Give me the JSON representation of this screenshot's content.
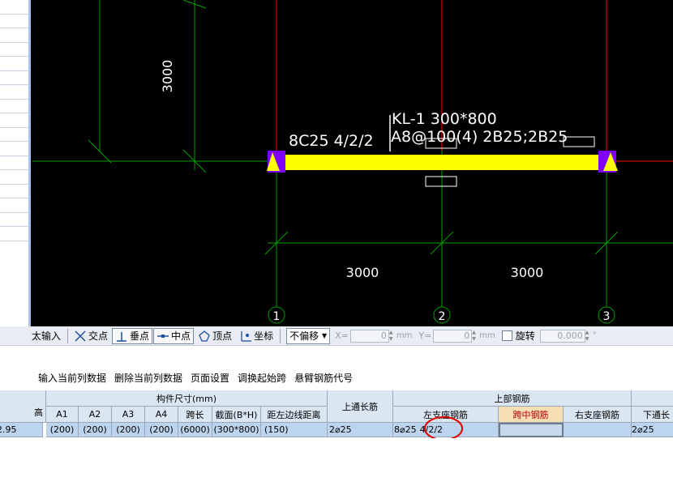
{
  "left_panel": {
    "row_count": 17
  },
  "drawing": {
    "grid_axes": [
      "1",
      "2",
      "3"
    ],
    "vertical_dimension": "3000",
    "span_dimensions": [
      "3000",
      "3000"
    ],
    "beam_name": "KL-1 300*800",
    "beam_stirrup_and_bars": "A8@100(4) 2B25;2B25",
    "left_support_label": "8C25 4/2/2",
    "colors": {
      "background": "#000000",
      "grid": "#00a000",
      "axis_red": "#ff0000",
      "beam": "#ffff00",
      "support": "#8000ff"
    }
  },
  "snap_toolbar": {
    "input_label": "太输入",
    "buttons": [
      {
        "label": "交点",
        "icon": "intersection-icon"
      },
      {
        "label": "垂点",
        "icon": "perpendicular-icon"
      },
      {
        "label": "中点",
        "icon": "midpoint-icon"
      },
      {
        "label": "顶点",
        "icon": "vertex-icon"
      },
      {
        "label": "坐标",
        "icon": "coordinate-icon"
      }
    ],
    "offset_select": "不偏移",
    "x_label": "X=",
    "x_value": "0",
    "x_unit": "mm",
    "y_label": "Y=",
    "y_value": "0",
    "y_unit": "mm",
    "rotate_label": "旋转",
    "rotate_value": "0.000",
    "degree_symbol": "°"
  },
  "menu": [
    "输入当前列数据",
    "删除当前列数据",
    "页面设置",
    "调换起始跨",
    "悬臂钢筋代号"
  ],
  "table": {
    "group_headers": {
      "component_size": "构件尺寸(mm)",
      "top_bars": "上部钢筋"
    },
    "col_headers": {
      "elevation_partial": "高",
      "a1": "A1",
      "a2": "A2",
      "a3": "A3",
      "a4": "A4",
      "span_length": "跨长",
      "section": "截面(B*H)",
      "left_edge_distance": "距左边线距离",
      "top_through_bars": "上通长筋",
      "left_support_bars": "左支座钢筋",
      "mid_span_bars": "跨中钢筋",
      "right_support_bars": "右支座钢筋",
      "bottom_through_bars": "下通长"
    },
    "row": {
      "elevation": "2.95",
      "a1": "(200)",
      "a2": "(200)",
      "a3": "(200)",
      "a4": "(200)",
      "span_length": "(6000)",
      "section": "(300*800)",
      "left_edge_distance": "(150)",
      "top_through_bars": "2⌀25",
      "left_support_count": "8⌀25",
      "left_support_layers": "4/2/2",
      "mid_span_bars": "",
      "right_support_bars": "",
      "bottom_through_bars": "2⌀25"
    }
  }
}
